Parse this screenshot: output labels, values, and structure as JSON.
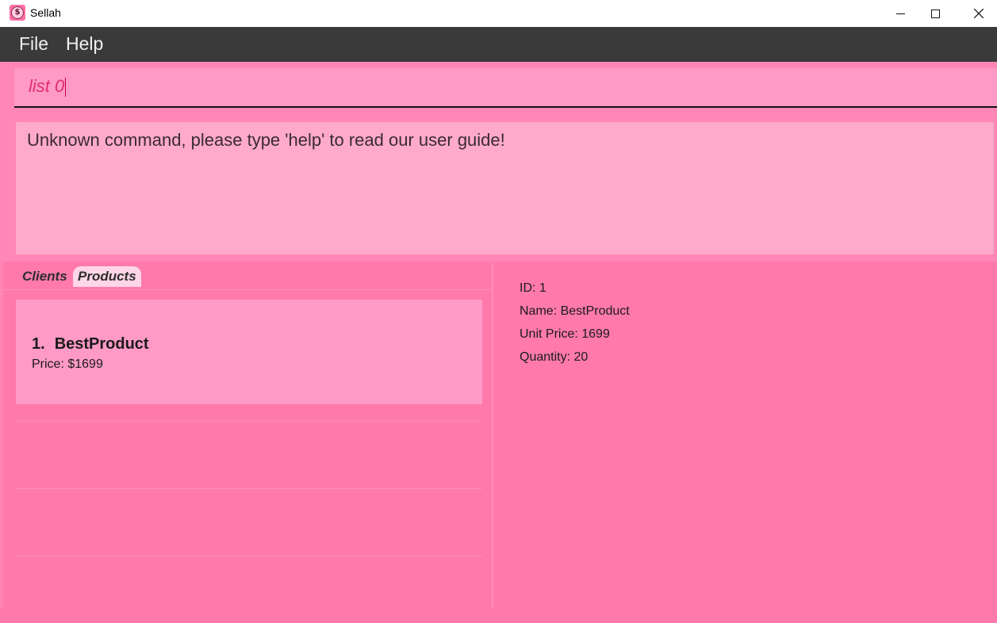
{
  "window": {
    "title": "Sellah",
    "icon": "dollar-coin-icon"
  },
  "menu": {
    "file_label": "File",
    "help_label": "Help"
  },
  "command": {
    "value": "list 0"
  },
  "result": {
    "message": "Unknown command, please type 'help' to read our user guide!"
  },
  "tabs": {
    "clients_label": "Clients",
    "products_label": "Products",
    "selected": "Products"
  },
  "product_list": [
    {
      "index": "1.",
      "name": "BestProduct",
      "price": "Price: $1699"
    }
  ],
  "detail": {
    "id": "ID: 1",
    "name": "Name: BestProduct",
    "unit_price": "Unit Price: 1699",
    "quantity": "Quantity: 20"
  },
  "colors": {
    "theme_pink": "#ff7aab",
    "menubar": "#3a3a3a",
    "command_text": "#e0306e"
  }
}
